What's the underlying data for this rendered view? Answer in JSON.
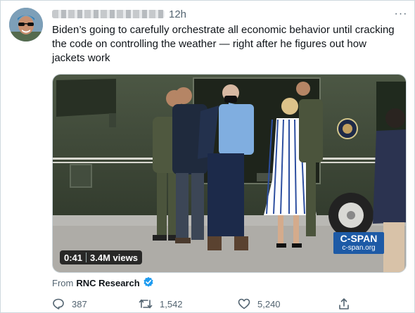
{
  "tweet": {
    "time": "12h",
    "more_icon": "more-dots-icon",
    "text": "Biden’s going to carefully orchestrate all economic behavior until cracking the code on controlling the weather — right after he figures out how jackets work"
  },
  "video": {
    "duration": "0:41",
    "views": "3.4M views",
    "watermark_top": "C-SPAN",
    "watermark_bottom": "c-span.org"
  },
  "attribution": {
    "prefix": "From",
    "source": "RNC Research",
    "verified_icon": "verified-badge-icon"
  },
  "actions": {
    "reply_count": "387",
    "retweet_count": "1,542",
    "like_count": "5,240"
  },
  "colors": {
    "verified": "#1d9bf0",
    "secondary_text": "#536471",
    "cspan_blue": "#1d5aa6"
  }
}
